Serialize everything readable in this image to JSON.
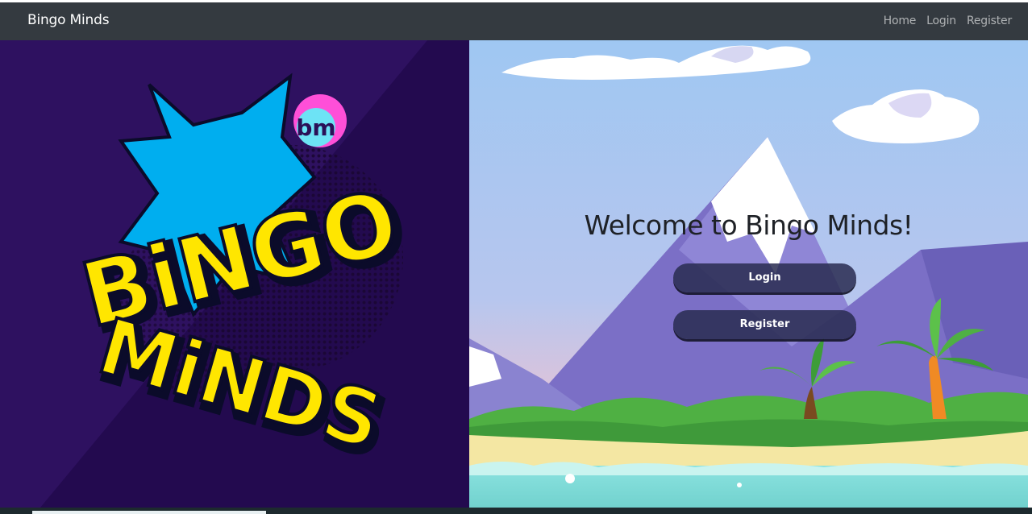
{
  "navbar": {
    "brand": "Bingo Minds",
    "links": [
      "Home",
      "Login",
      "Register"
    ]
  },
  "hero": {
    "welcome": "Welcome to Bingo Minds!",
    "login_label": "Login",
    "register_label": "Register"
  },
  "logo": {
    "badge_text": "bm",
    "line1": "BiNGO",
    "line2": "MiNDS"
  },
  "colors": {
    "navbar": "#343a40",
    "left_bg": "#2a1057",
    "logo_yellow": "#ffe600",
    "logo_blue": "#00aeef",
    "badge_pink": "#ff4fd8",
    "button": "#2a2c52"
  }
}
